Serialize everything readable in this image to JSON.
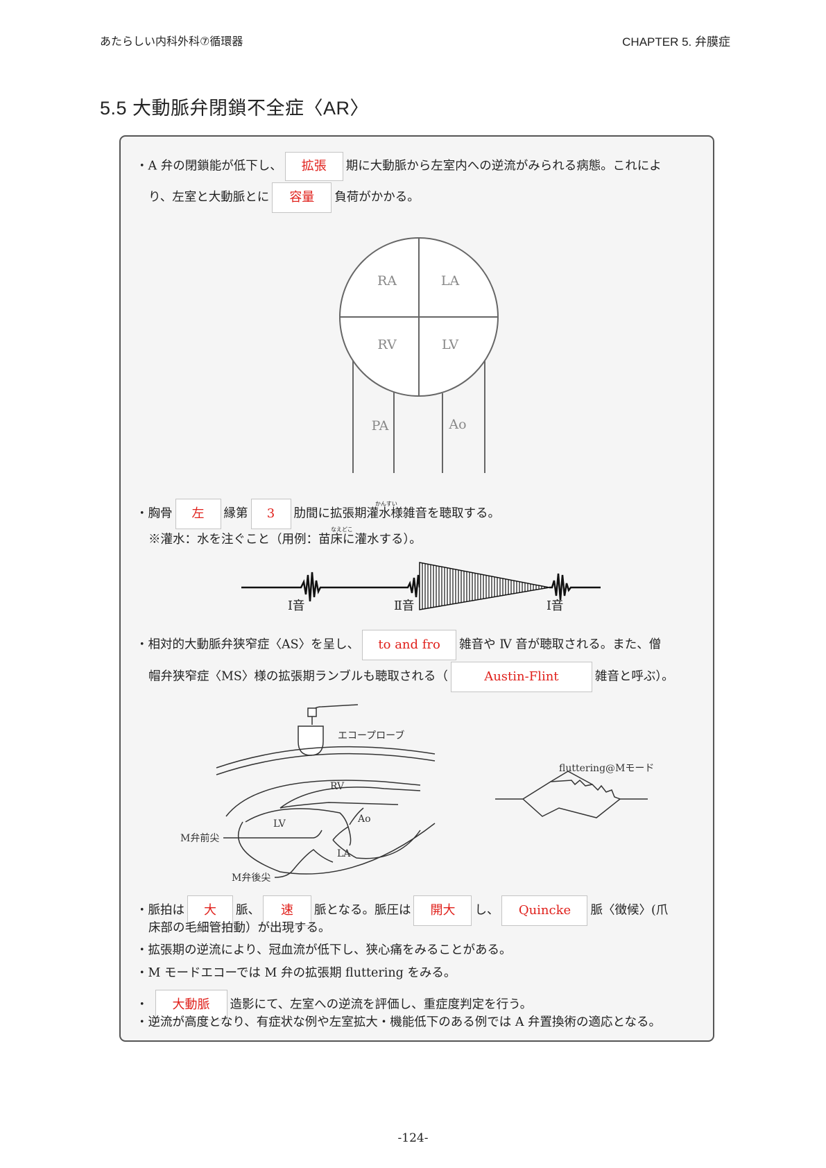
{
  "header": {
    "left": "あたらしい内科外科⑦循環器",
    "right": "CHAPTER 5. 弁膜症"
  },
  "title": "5.5 大動脈弁閉鎖不全症〈AR〉",
  "para1": {
    "l1_a": "・A 弁の閉鎖能が低下し、",
    "box1": "拡張",
    "l1_b": "期に大動脈から左室内への逆流がみられる病態。これによ",
    "l2_a": "り、左室と大動脈とに",
    "box2": "容量",
    "l2_b": "負荷がかかる。"
  },
  "heart": {
    "ra": "RA",
    "la": "LA",
    "rv": "RV",
    "lv": "LV",
    "pa": "PA",
    "ao": "Ao"
  },
  "para2": {
    "l1_a": "・胸骨",
    "box1": "左",
    "l1_b": "縁第",
    "box2": "3",
    "l1_c": "肋間に拡張期灌水様雑音を聴取する。",
    "ruby1": "かんすい",
    "l2": "※灌水：水を注ぐこと（用例：苗床に灌水する）。",
    "ruby2": "なえどこ"
  },
  "phono": {
    "s1_left": "Ⅰ音",
    "s2": "Ⅱ音",
    "s1_right": "Ⅰ音"
  },
  "para3": {
    "l1_a": "・相対的大動脈弁狭窄症〈AS〉を呈し、",
    "box1": "to and fro",
    "l1_b": "雑音や Ⅳ 音が聴取される。また、僧",
    "l2_a": "帽弁狭窄症〈MS〉様の拡張期ランブルも聴取される（",
    "box2": "Austin-Flint",
    "l2_b": "雑音と呼ぶ）。"
  },
  "echo": {
    "probe": "エコープローブ",
    "rv": "RV",
    "lv": "LV",
    "ao": "Ao",
    "la": "LA",
    "m_ant": "M弁前尖",
    "m_post": "M弁後尖",
    "flutter": "fluttering@Mモード"
  },
  "para4": {
    "l1_a": "・脈拍は",
    "box1": "大",
    "l1_b": "脈、",
    "box2": "速",
    "l1_c": "脈となる。脈圧は",
    "box3": "開大",
    "l1_d": "し、",
    "box4": "Quincke",
    "l1_e": "脈〈徴候〉(爪",
    "l2": "床部の毛細管拍動）が出現する。"
  },
  "bullets": {
    "b1": "・拡張期の逆流により、冠血流が低下し、狭心痛をみることがある。",
    "b2": "・M モードエコーでは M 弁の拡張期 fluttering をみる。",
    "b3_a": "・",
    "b3_box": "大動脈",
    "b3_b": "造影にて、左室への逆流を評価し、重症度判定を行う。",
    "b4": "・逆流が高度となり、有症状な例や左室拡大・機能低下のある例では A 弁置換術の適応となる。"
  },
  "page_number": "-124-"
}
